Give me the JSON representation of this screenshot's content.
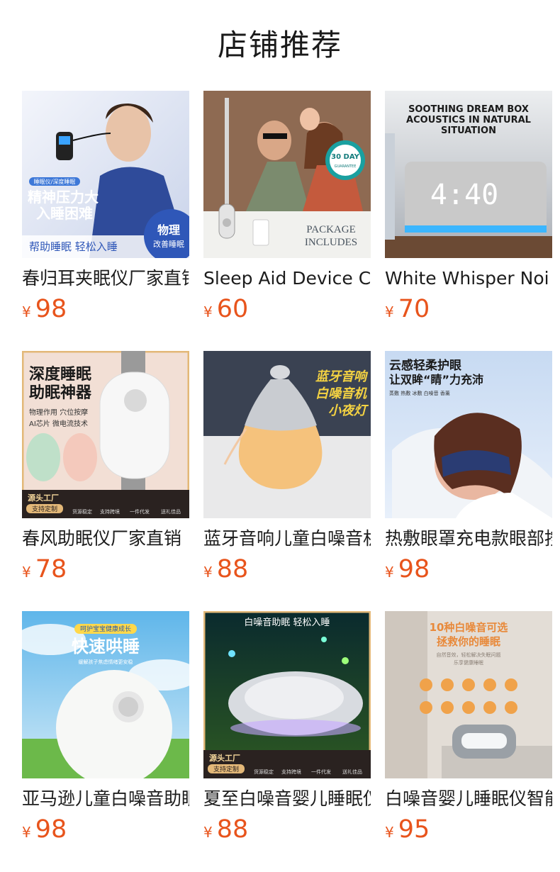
{
  "header": {
    "title": "店铺推荐"
  },
  "products": [
    {
      "name": "春归耳夹眠仪厂家直销",
      "currency": "¥",
      "price": "98",
      "image": {
        "badge": "睡眠仪/深度睡眠",
        "headline1": "精神压力大",
        "headline2": "入睡困难",
        "footer": "帮助睡眠 轻松入睡",
        "seal1": "物理",
        "seal2": "改善睡眠"
      }
    },
    {
      "name": "Sleep Aid Device Ca",
      "currency": "¥",
      "price": "60",
      "image": {
        "seal1": "30 DAY",
        "seal2": "GUARANTEE",
        "caption1": "PACKAGE",
        "caption2": "INCLUDES"
      }
    },
    {
      "name": "White Whisper Noi",
      "currency": "¥",
      "price": "70",
      "image": {
        "line1": "SOOTHING DREAM BOX",
        "line2": "ACOUSTICS IN NATURAL",
        "line3": "SITUATION",
        "clock": "4:40"
      }
    },
    {
      "name": "春风助眠仪厂家直销",
      "currency": "¥",
      "price": "78",
      "image": {
        "headline1": "深度睡眠",
        "headline2": "助眠神器",
        "sub1": "物理作用 穴位按摩",
        "sub2": "AI芯片 微电流技术",
        "factory": "源头工厂",
        "custom": "支持定制",
        "features": [
          "货源稳定",
          "支持跨境",
          "一件代发",
          "送礼佳品"
        ]
      }
    },
    {
      "name": "蓝牙音响儿童白噪音机",
      "currency": "¥",
      "price": "88",
      "image": {
        "line1": "蓝牙音响",
        "line2": "白噪音机",
        "line3": "小夜灯"
      }
    },
    {
      "name": "热敷眼罩充电款眼部按摩",
      "currency": "¥",
      "price": "98",
      "image": {
        "line1": "云感轻柔护眼",
        "line2": "让双眸“睛”力充沛",
        "sub": "蒸敷 热敷 冰敷 白噪音 香薰"
      }
    },
    {
      "name": "亚马逊儿童白噪音助眠",
      "currency": "¥",
      "price": "98",
      "image": {
        "badge": "呵护宝宝健康成长",
        "headline": "快速哄睡",
        "sub": "缓解孩子焦虑情绪更安稳"
      }
    },
    {
      "name": "夏至白噪音婴儿睡眠仪",
      "currency": "¥",
      "price": "88",
      "image": {
        "headline": "白噪音助眠 轻松入睡",
        "factory": "源头工厂",
        "custom": "支持定制",
        "features": [
          "货源稳定",
          "支持跨境",
          "一件代发",
          "送礼佳品"
        ]
      }
    },
    {
      "name": "白噪音婴儿睡眠仪智能",
      "currency": "¥",
      "price": "95",
      "image": {
        "headline1": "10种白噪音可选",
        "headline2": "拯救你的睡眠",
        "sub1": "自然音效，轻松解决失眠问题",
        "sub2": "乐享健康睡眠"
      }
    }
  ],
  "colors": {
    "price": "#e8541c",
    "title": "#1a1a1a"
  }
}
